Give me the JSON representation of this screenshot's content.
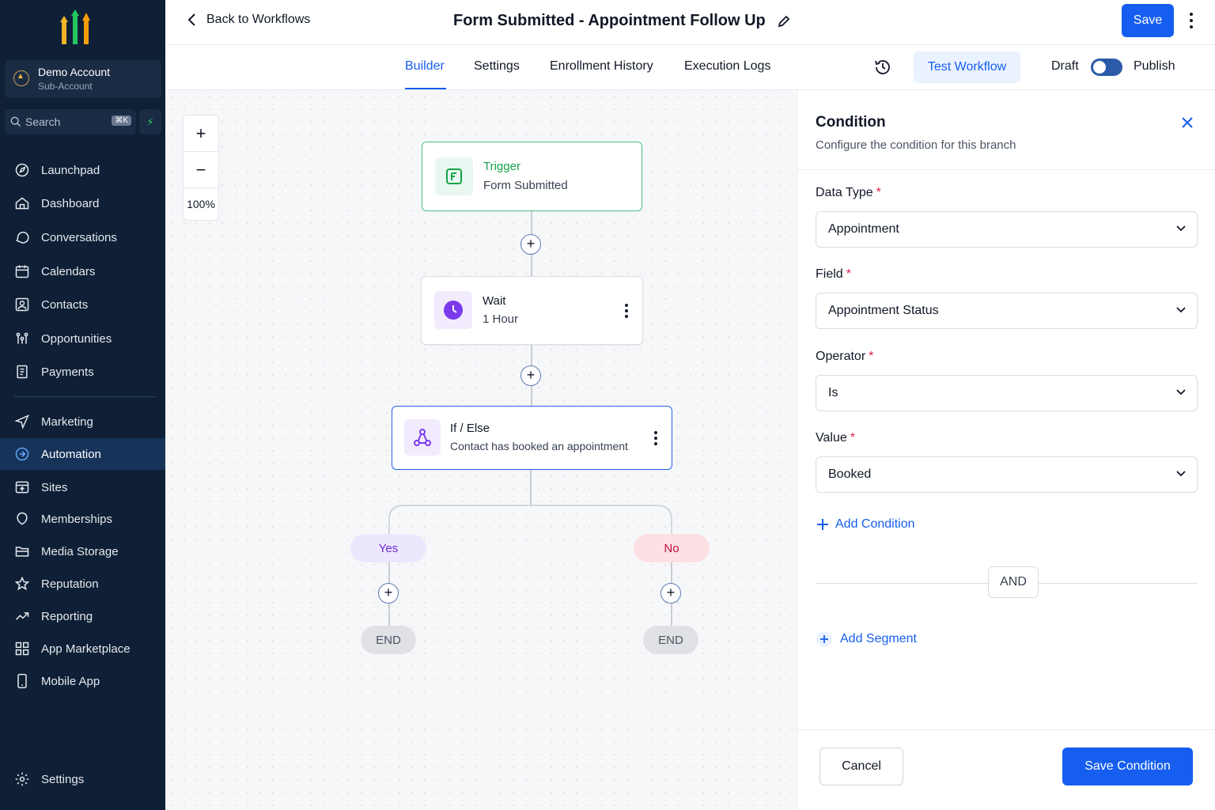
{
  "sidebar": {
    "account": {
      "name": "Demo Account",
      "type": "Sub-Account"
    },
    "search": {
      "placeholder": "Search",
      "shortcut": "⌘K"
    },
    "items": [
      {
        "label": "Launchpad",
        "icon": "rocket-icon"
      },
      {
        "label": "Dashboard",
        "icon": "gauge-icon"
      },
      {
        "label": "Conversations",
        "icon": "chat-icon"
      },
      {
        "label": "Calendars",
        "icon": "calendar-icon"
      },
      {
        "label": "Contacts",
        "icon": "contact-icon"
      },
      {
        "label": "Opportunities",
        "icon": "funnel-icon"
      },
      {
        "label": "Payments",
        "icon": "receipt-icon"
      },
      {
        "label": "Marketing",
        "icon": "send-icon"
      },
      {
        "label": "Automation",
        "icon": "automation-icon",
        "active": true
      },
      {
        "label": "Sites",
        "icon": "site-icon"
      },
      {
        "label": "Memberships",
        "icon": "badge-icon"
      },
      {
        "label": "Media Storage",
        "icon": "folder-icon"
      },
      {
        "label": "Reputation",
        "icon": "star-icon"
      },
      {
        "label": "Reporting",
        "icon": "trend-icon"
      },
      {
        "label": "App Marketplace",
        "icon": "grid-icon"
      },
      {
        "label": "Mobile App",
        "icon": "phone-icon"
      }
    ],
    "settings": "Settings"
  },
  "header": {
    "back": "Back to Workflows",
    "title": "Form Submitted - Appointment Follow Up",
    "save": "Save"
  },
  "tabs": {
    "items": [
      "Builder",
      "Settings",
      "Enrollment History",
      "Execution Logs"
    ],
    "active": "Builder",
    "test_workflow": "Test Workflow",
    "draft": "Draft",
    "publish": "Publish"
  },
  "canvas": {
    "zoom": "100%",
    "trigger": {
      "label": "Trigger",
      "value": "Form Submitted"
    },
    "wait": {
      "label": "Wait",
      "value": "1 Hour"
    },
    "ifelse": {
      "label": "If / Else",
      "value": "Contact has booked an appointment"
    },
    "branches": {
      "yes": "Yes",
      "no": "No",
      "end": "END"
    }
  },
  "panel": {
    "title": "Condition",
    "subtitle": "Configure the condition for this branch",
    "fields": [
      {
        "label": "Data Type",
        "value": "Appointment"
      },
      {
        "label": "Field",
        "value": "Appointment Status"
      },
      {
        "label": "Operator",
        "value": "Is"
      },
      {
        "label": "Value",
        "value": "Booked"
      }
    ],
    "add_condition": "Add Condition",
    "and": "AND",
    "add_segment": "Add Segment",
    "cancel": "Cancel",
    "save_condition": "Save Condition"
  },
  "colors": {
    "sidebar_bg": "#0f1f35",
    "primary": "#155eef",
    "trigger_green": "#16a34a",
    "wait_purple": "#7c3aed",
    "yes_bg": "#ede7fd",
    "no_bg": "#fde0e4"
  }
}
